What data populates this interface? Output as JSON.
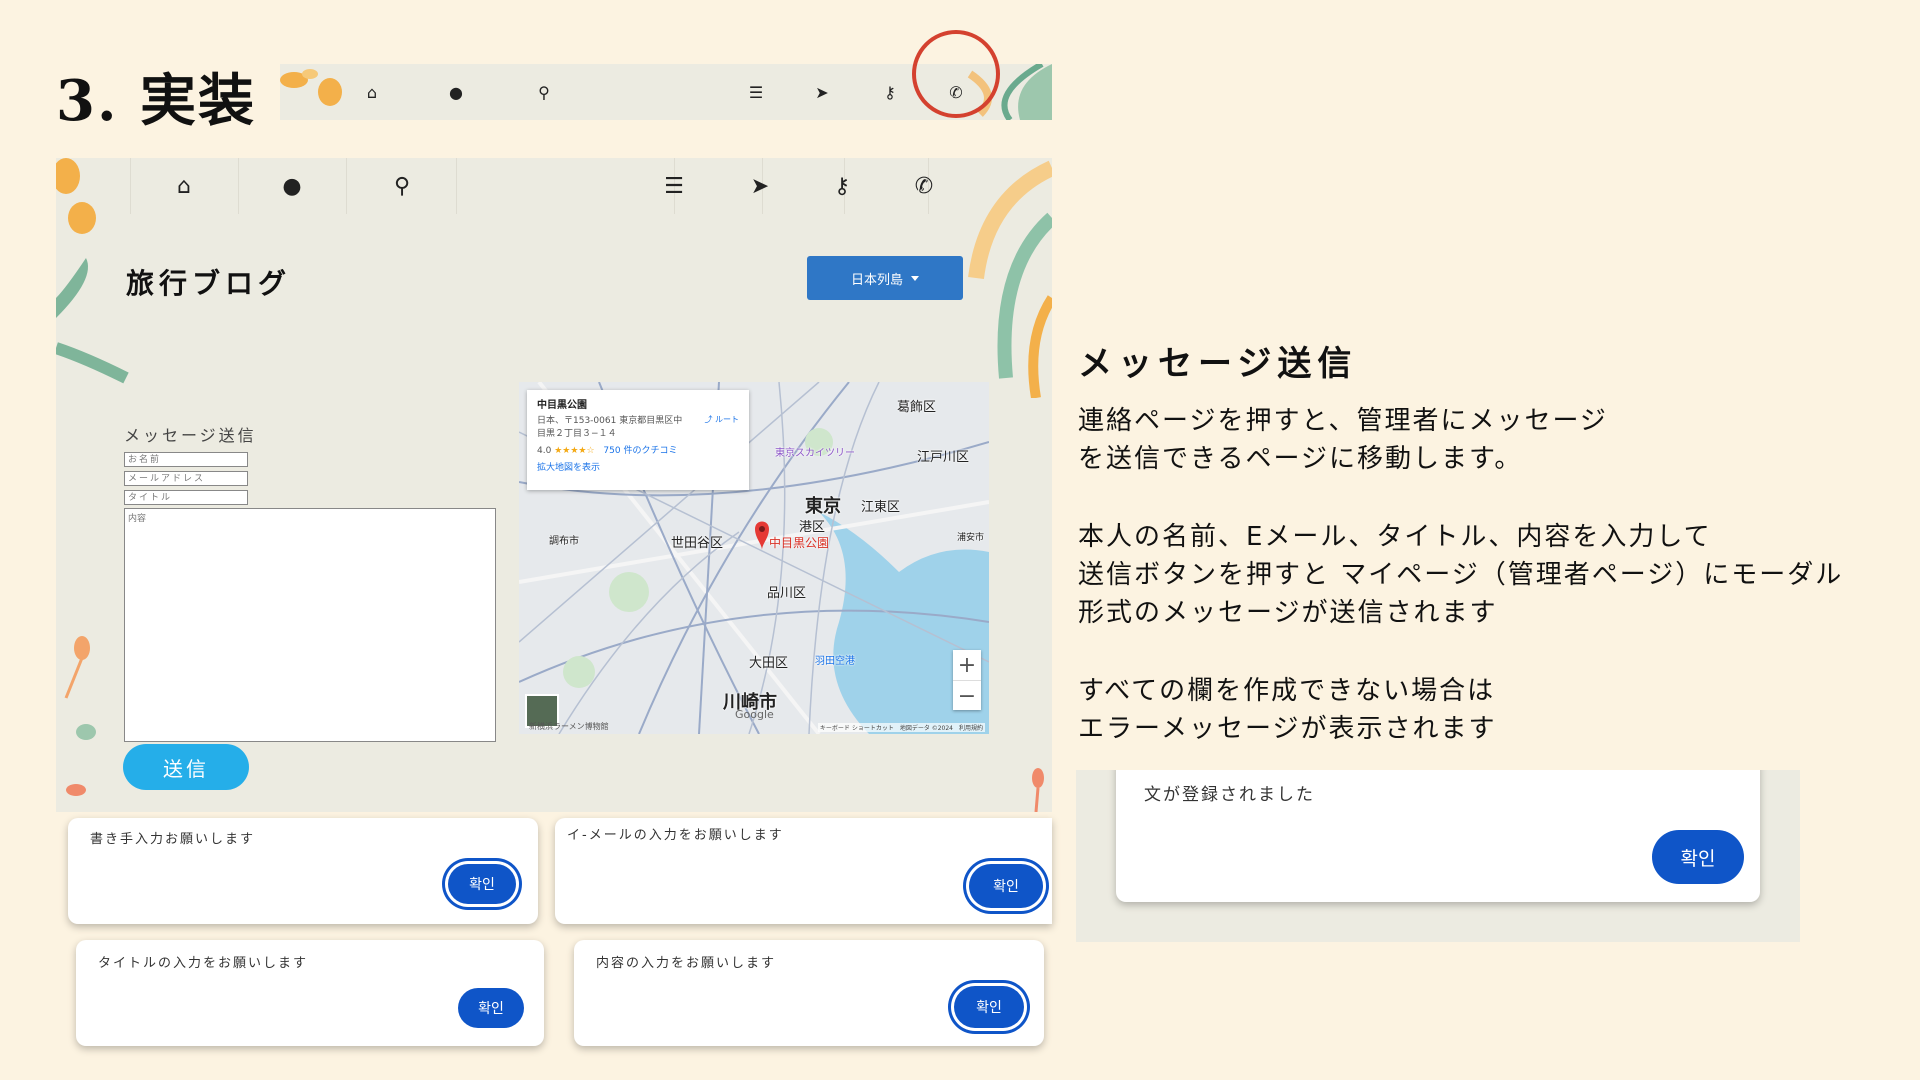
{
  "slide": {
    "title": "3. 実装",
    "heading": "メッセージ送信",
    "paragraphs": [
      {
        "lines": [
          "連絡ページを押すと、管理者にメッセージ",
          "を送信できるページに移動します。"
        ]
      },
      {
        "lines": [
          "本人の名前、Eメール、タイトル、内容を入力して",
          "送信ボタンを押すと マイページ（管理者ページ）にモーダル",
          "形式のメッセージが送信されます"
        ]
      },
      {
        "lines": [
          "すべての欄を作成できない場合は",
          "エラーメッセージが表示されます"
        ]
      }
    ]
  },
  "nav": {
    "icons": [
      "home-icon",
      "user-circle-icon",
      "search-icon",
      "list-icon",
      "paper-plane-icon",
      "key-icon",
      "phone-icon"
    ],
    "highlight_color": "#d4412f"
  },
  "app": {
    "blog_title": "旅行ブログ",
    "dropdown_label": "日本列島",
    "form": {
      "title": "メッセージ送信",
      "name_placeholder": "お名前",
      "email_placeholder": "メールアドレス",
      "subject_placeholder": "タイトル",
      "content_placeholder": "内容",
      "send_label": "送信"
    },
    "map": {
      "place_name": "中目黒公園",
      "address": "日本、〒153-0061 東京都目黒区中目黒２丁目３−１４",
      "rating": "4.0",
      "stars": "★★★★☆",
      "reviews": "750 件のクチコミ",
      "larger_map": "拡大地図を表示",
      "route": "ルート",
      "labels": {
        "tokyo": "東京",
        "koto": "江東区",
        "minato": "港区",
        "setagaya": "世田谷区",
        "shinagawa": "品川区",
        "ota": "大田区",
        "kawasaki": "川崎市",
        "katsushika": "葛飾区",
        "edogawa": "江戸川区",
        "pin": "中目黒公園",
        "skytree": "東京スカイツリー",
        "haneda": "羽田空港",
        "chofu": "調布市",
        "urayasu": "浦安市"
      },
      "google": "Google",
      "footer": "キーボード ショートカット　地図データ ©2024　利用規約",
      "footer_left": "新横浜ラーメン博物館"
    }
  },
  "dialogs": [
    {
      "message": "書き手入力お願いします",
      "button": "확인"
    },
    {
      "message": "イ-メールの入力をお願いします",
      "button": "확인"
    },
    {
      "message": "タイトルの入力をお願いします",
      "button": "확인"
    },
    {
      "message": "内容の入力をお願いします",
      "button": "확인"
    }
  ],
  "success_dialog": {
    "message": "文が登録されました",
    "button": "확인"
  }
}
